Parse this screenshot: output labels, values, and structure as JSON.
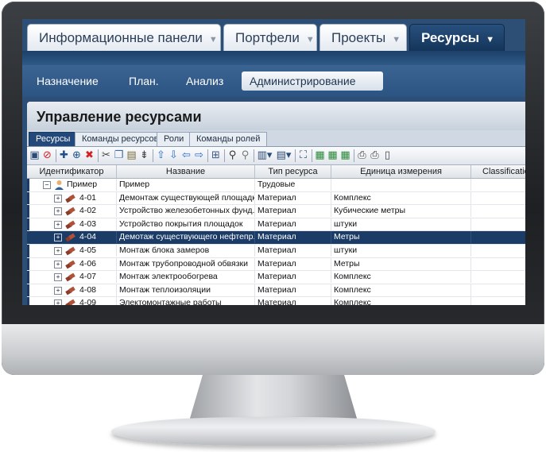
{
  "top_tabs": [
    {
      "label": "Информационные панели",
      "active": false
    },
    {
      "label": "Портфели",
      "active": false
    },
    {
      "label": "Проекты",
      "active": false
    },
    {
      "label": "Ресурсы",
      "active": true
    }
  ],
  "sub_nav": [
    {
      "label": "Назначение",
      "active": false
    },
    {
      "label": "План.",
      "active": false
    },
    {
      "label": "Анализ",
      "active": false
    },
    {
      "label": "Администрирование",
      "active": true
    }
  ],
  "panel": {
    "title": "Управление ресурсами",
    "tabs": [
      {
        "label": "Ресурсы",
        "active": true
      },
      {
        "label": "Команды ресурсов",
        "active": false
      },
      {
        "label": "Роли",
        "active": false
      },
      {
        "label": "Команды ролей",
        "active": false
      }
    ]
  },
  "toolbar_icons": [
    "save-icon",
    "cancel-icon",
    "add-icon",
    "add-child-icon",
    "delete-icon",
    "cut-icon",
    "copy-icon",
    "paste-icon",
    "indent-icon",
    "move-up-icon",
    "move-down-icon",
    "outdent-icon",
    "indent-right-icon",
    "assign-icon",
    "find-icon",
    "find-next-icon",
    "columns-icon",
    "view-icon",
    "fit-icon",
    "export-icon",
    "import-icon",
    "report-icon",
    "print-icon",
    "print-preview-icon",
    "page-setup-icon"
  ],
  "colors": {
    "accent": "#1b3c66",
    "active_tab": "#14355a",
    "resource_icon": "#8c3a2a"
  },
  "grid": {
    "columns": [
      "Идентификатор",
      "Название",
      "Тип ресурса",
      "Единица измерения",
      "Classificatio"
    ],
    "rows": [
      {
        "id": "Пример",
        "name": "Пример",
        "type": "Трудовые",
        "unit": "",
        "expander": "−",
        "icon": "person-icon",
        "selected": false
      },
      {
        "id": "4-01",
        "name": "Демонтаж существующей площадки",
        "type": "Материал",
        "unit": "Комплекс",
        "expander": "+",
        "icon": "material-icon",
        "selected": false
      },
      {
        "id": "4-02",
        "name": "Устройство железобетонных фунд...",
        "type": "Материал",
        "unit": "Кубические метры",
        "expander": "+",
        "icon": "material-icon",
        "selected": false
      },
      {
        "id": "4-03",
        "name": "Устройство покрытия площадок",
        "type": "Материал",
        "unit": "штуки",
        "expander": "+",
        "icon": "material-icon",
        "selected": false
      },
      {
        "id": "4-04",
        "name": "Демотаж существующего нефтепр...",
        "type": "Материал",
        "unit": "Метры",
        "expander": "+",
        "icon": "material-icon",
        "selected": true
      },
      {
        "id": "4-05",
        "name": "Монтаж блока замеров",
        "type": "Материал",
        "unit": "штуки",
        "expander": "+",
        "icon": "material-icon",
        "selected": false
      },
      {
        "id": "4-06",
        "name": "Монтаж трубопроводной обвязки",
        "type": "Материал",
        "unit": "Метры",
        "expander": "+",
        "icon": "material-icon",
        "selected": false
      },
      {
        "id": "4-07",
        "name": "Монтаж электрообогрева",
        "type": "Материал",
        "unit": "Комплекс",
        "expander": "+",
        "icon": "material-icon",
        "selected": false
      },
      {
        "id": "4-08",
        "name": "Монтаж теплоизоляции",
        "type": "Материал",
        "unit": "Комплекс",
        "expander": "+",
        "icon": "material-icon",
        "selected": false
      },
      {
        "id": "4-09",
        "name": "Электомонтажные работы",
        "type": "Материал",
        "unit": "Комплекс",
        "expander": "+",
        "icon": "material-icon",
        "selected": false
      }
    ]
  }
}
